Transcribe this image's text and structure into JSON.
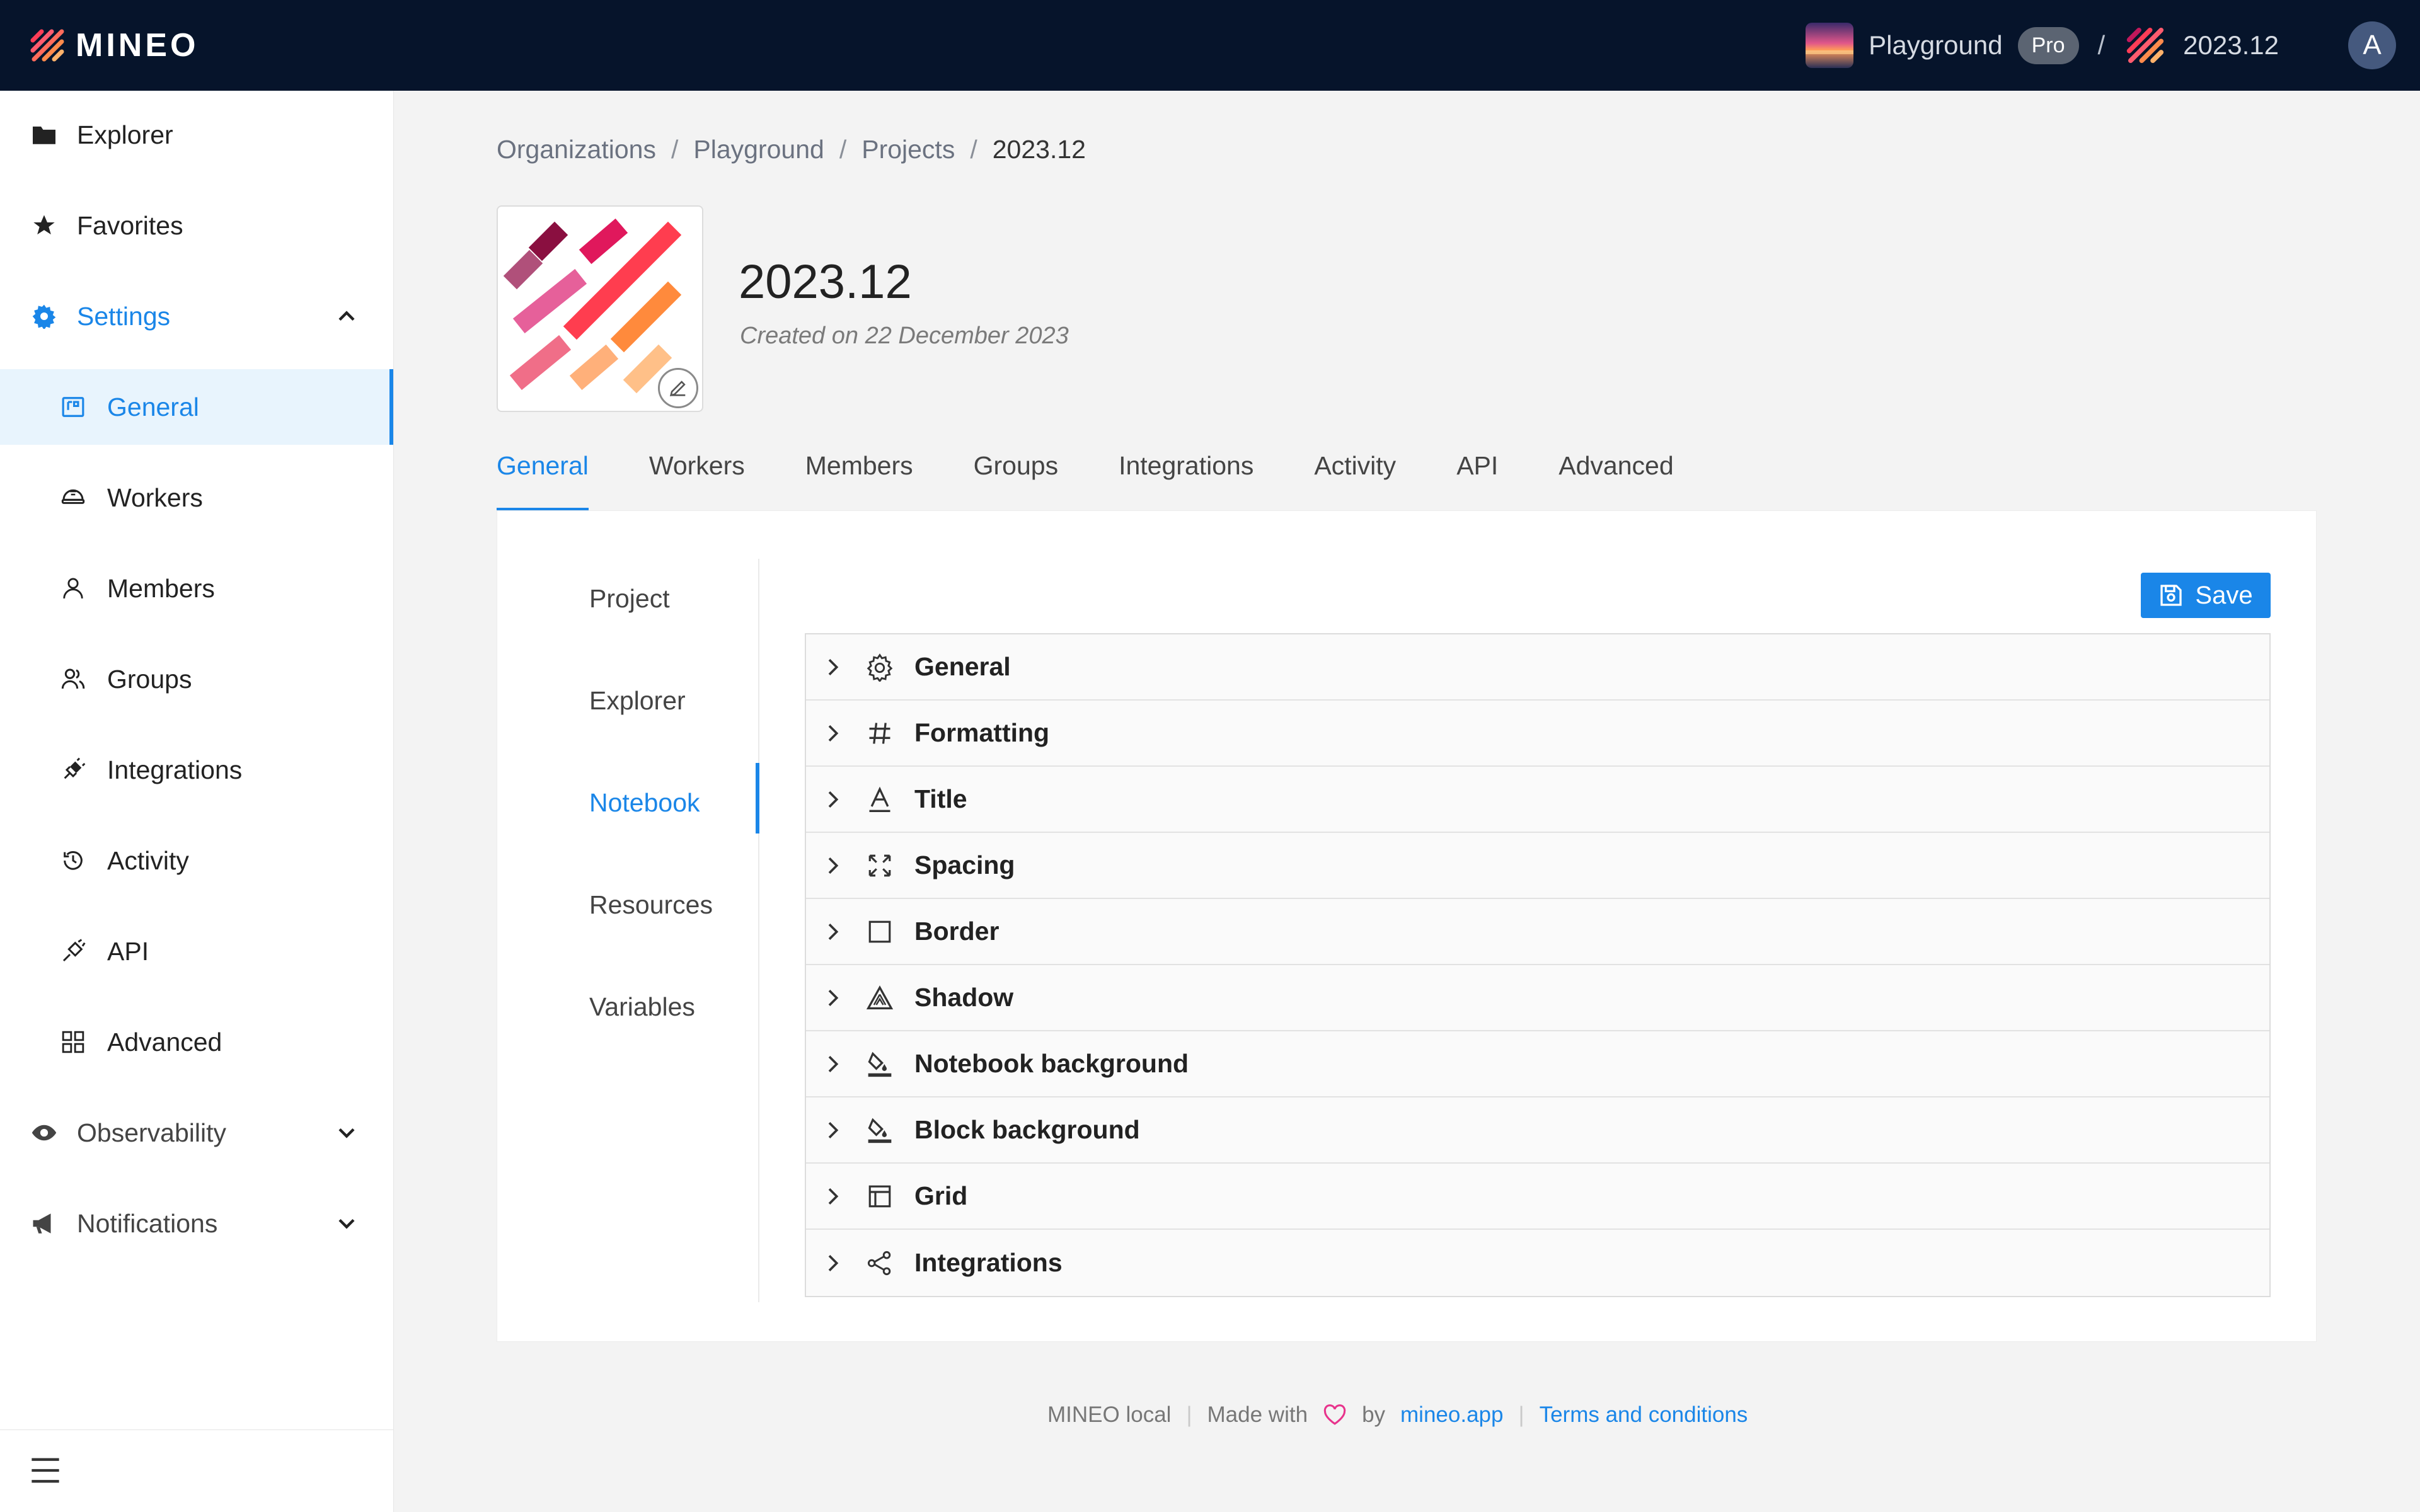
{
  "app": {
    "brand": "MINEO"
  },
  "topbar": {
    "workspace": "Playground",
    "plan_badge": "Pro",
    "separator": "/",
    "project": "2023.12",
    "avatar_initial": "A"
  },
  "sidebar": {
    "items": [
      {
        "label": "Explorer",
        "icon": "folder-icon"
      },
      {
        "label": "Favorites",
        "icon": "star-icon"
      },
      {
        "label": "Settings",
        "icon": "gear-icon",
        "expanded": true
      },
      {
        "label": "General",
        "icon": "dashboard-icon",
        "active": true
      },
      {
        "label": "Workers",
        "icon": "worker-icon"
      },
      {
        "label": "Members",
        "icon": "person-icon"
      },
      {
        "label": "Groups",
        "icon": "group-icon"
      },
      {
        "label": "Integrations",
        "icon": "plug-icon"
      },
      {
        "label": "Activity",
        "icon": "history-icon"
      },
      {
        "label": "API",
        "icon": "api-icon"
      },
      {
        "label": "Advanced",
        "icon": "grid-icon"
      },
      {
        "label": "Observability",
        "icon": "eye-icon",
        "expanded": false
      },
      {
        "label": "Notifications",
        "icon": "megaphone-icon",
        "expanded": false
      }
    ]
  },
  "breadcrumb": {
    "items": [
      "Organizations",
      "Playground",
      "Projects",
      "2023.12"
    ],
    "separator": "/"
  },
  "project": {
    "title": "2023.12",
    "created": "Created on 22 December 2023"
  },
  "tabs": [
    "General",
    "Workers",
    "Members",
    "Groups",
    "Integrations",
    "Activity",
    "API",
    "Advanced"
  ],
  "subnav": [
    "Project",
    "Explorer",
    "Notebook",
    "Resources",
    "Variables"
  ],
  "save_label": "Save",
  "accordion": [
    {
      "label": "General",
      "icon": "gear-icon"
    },
    {
      "label": "Formatting",
      "icon": "hash-icon"
    },
    {
      "label": "Title",
      "icon": "text-icon"
    },
    {
      "label": "Spacing",
      "icon": "expand-icon"
    },
    {
      "label": "Border",
      "icon": "square-icon"
    },
    {
      "label": "Shadow",
      "icon": "shadow-icon"
    },
    {
      "label": "Notebook background",
      "icon": "paint-bucket-icon"
    },
    {
      "label": "Block background",
      "icon": "paint-bucket-icon"
    },
    {
      "label": "Grid",
      "icon": "table-icon"
    },
    {
      "label": "Integrations",
      "icon": "share-icon"
    }
  ],
  "footer": {
    "local": "MINEO local",
    "made_with": "Made with",
    "by": "by",
    "site": "mineo.app",
    "terms": "Terms and conditions",
    "separator": "|"
  },
  "colors": {
    "topbar_bg": "#06142b",
    "accent": "#1a86e8",
    "background": "#f3f3f3"
  }
}
